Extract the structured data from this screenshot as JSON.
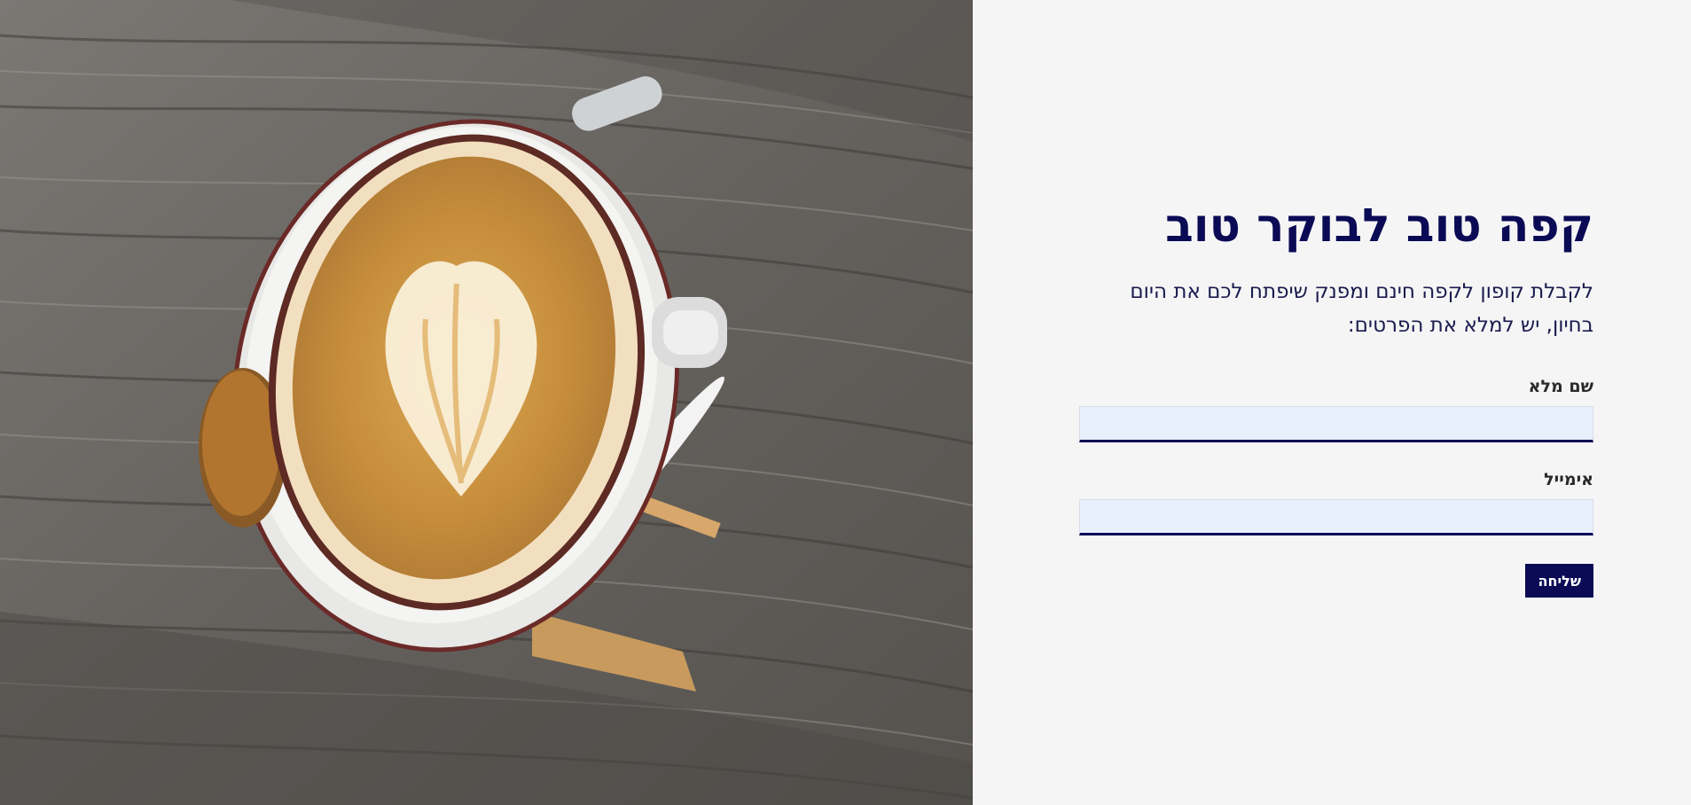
{
  "hero": {
    "image": "latte-art-coffee-cup-on-wooden-table"
  },
  "form": {
    "title": "קפה טוב לבוקר טוב",
    "description": "לקבלת קופון לקפה חינם ומפנק שיפתח לכם את היום בחיון, יש למלא את הפרטים:",
    "name_label": "שם מלא",
    "name_value": "",
    "email_label": "אימייל",
    "email_value": "",
    "submit_label": "שליחה"
  },
  "colors": {
    "brand": "#0a0a55",
    "input_bg": "#e8f0fe",
    "panel_bg": "#f5f5f5"
  }
}
